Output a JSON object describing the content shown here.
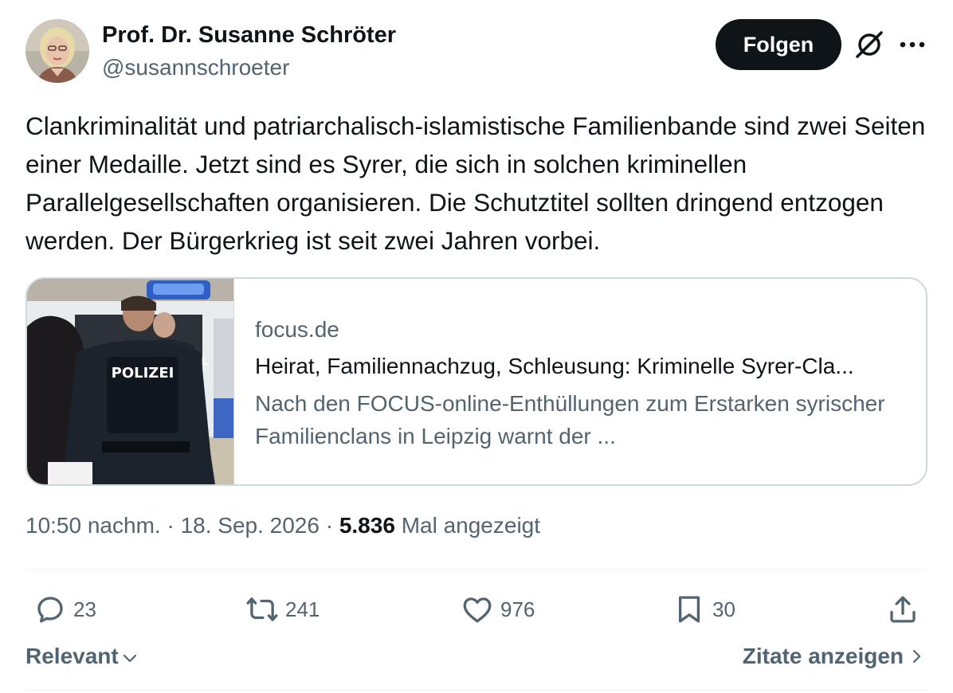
{
  "author": {
    "name": "Prof. Dr. Susanne Schröter",
    "handle": "@susannschroeter"
  },
  "header": {
    "follow_label": "Folgen",
    "icons": [
      "grok-icon",
      "more-icon"
    ]
  },
  "tweet": {
    "text": "Clankriminalität und patriarchalisch-islamistische Familienbande sind zwei Seiten einer Medaille. Jetzt sind es Syrer, die sich in solchen kriminellen Parallelgesellschaften organisieren. Die Schutztitel sollten dringend entzogen werden. Der Bürgerkrieg ist seit zwei Jahren vorbei."
  },
  "card": {
    "domain": "focus.de",
    "title": "Heirat, Familiennachzug, Schleusung: Kriminelle Syrer-Cla...",
    "description": "Nach den FOCUS-online-Enthüllungen zum Erstarken syrischer Familienclans in Leipzig warnt der ...",
    "image_text": "POLIZEI"
  },
  "meta": {
    "time": "10:50 nachm.",
    "separator": "·",
    "date": "18. Sep. 2026",
    "views_count": "5.836",
    "views_label": "Mal angezeigt"
  },
  "actions": {
    "replies": "23",
    "reposts": "241",
    "likes": "976",
    "bookmarks": "30"
  },
  "footer": {
    "sort_label": "Relevant",
    "quotes_label": "Zitate anzeigen"
  },
  "colors": {
    "text_primary": "#0f1419",
    "text_secondary": "#536471",
    "border": "#cfd9de",
    "follow_bg": "#0f1419"
  }
}
